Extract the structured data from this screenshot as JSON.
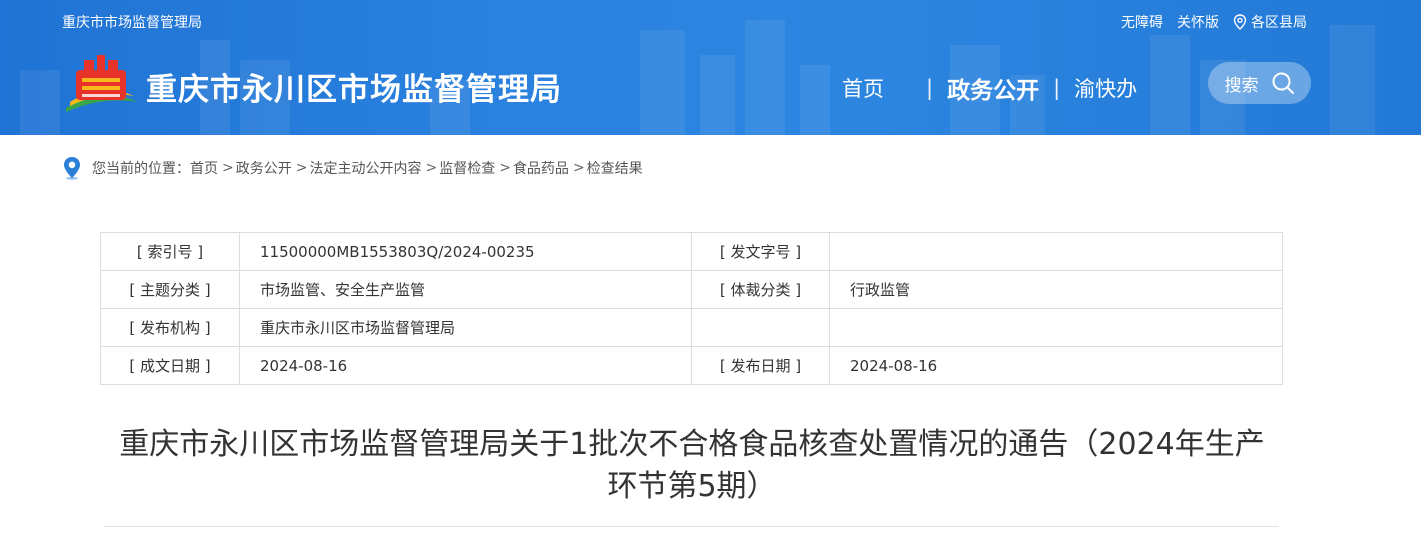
{
  "header": {
    "top_left": "重庆市市场监督管理局",
    "accessibility": "无障碍",
    "care_version": "关怀版",
    "districts": "各区县局",
    "site_title": "重庆市永川区市场监督管理局",
    "nav": {
      "home": "首页",
      "gov_affairs": "政务公开",
      "yu_kuai_ban": "渝快办",
      "separator": "|"
    },
    "search_label": "搜索"
  },
  "breadcrumb": {
    "prefix": "您当前的位置：",
    "items": [
      "首页",
      "政务公开",
      "法定主动公开内容",
      "监督检查",
      "食品药品",
      "检查结果"
    ],
    "arrow": ">"
  },
  "meta": {
    "rows": [
      {
        "label1": "[ 索引号 ]",
        "value1": "11500000MB1553803Q/2024-00235",
        "label2": "[ 发文字号 ]",
        "value2": ""
      },
      {
        "label1": "[ 主题分类 ]",
        "value1": "市场监管、安全生产监管",
        "label2": "[ 体裁分类 ]",
        "value2": "行政监管"
      },
      {
        "label1": "[ 发布机构 ]",
        "value1": "重庆市永川区市场监督管理局",
        "label2": "",
        "value2": ""
      },
      {
        "label1": "[ 成文日期 ]",
        "value1": "2024-08-16",
        "label2": "[ 发布日期 ]",
        "value2": "2024-08-16"
      }
    ]
  },
  "notice": {
    "title_line1": "重庆市永川区市场监督管理局关于1批次不合格食品核查处置情况的通告（2024年生产",
    "title_line2": "环节第5期）"
  },
  "colors": {
    "header_blue": "#2a81de",
    "logo_red": "#e8332a",
    "logo_yellow": "#f6b81b",
    "logo_green": "#3aa64a"
  },
  "icons": [
    "location-pin-icon",
    "search-icon",
    "breadcrumb-location-icon",
    "site-logo"
  ]
}
